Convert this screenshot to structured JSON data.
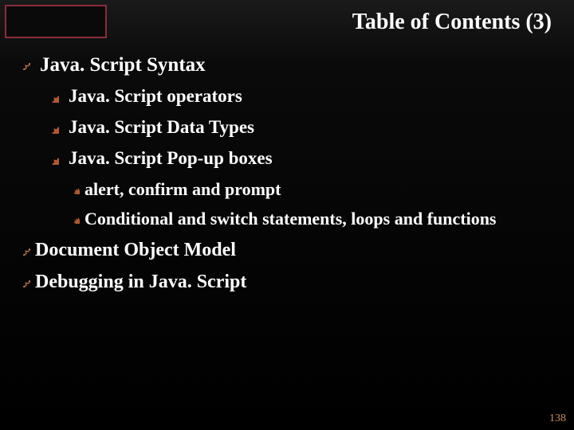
{
  "title": "Table of Contents (3)",
  "items": {
    "syntax": "Java. Script Syntax",
    "operators": "Java. Script operators",
    "datatypes": "Java. Script Data Types",
    "popup": "Java. Script Pop-up boxes",
    "alert": "alert, confirm and prompt",
    "cond": "Conditional and switch statements, loops and functions",
    "dom": "Document Object Model",
    "debug": "Debugging in Java. Script"
  },
  "page_number": "138",
  "colors": {
    "bullet_solid": "#b0592f",
    "bullet_outline": "#c27a4e",
    "logo_border": "#8b2d3a"
  }
}
